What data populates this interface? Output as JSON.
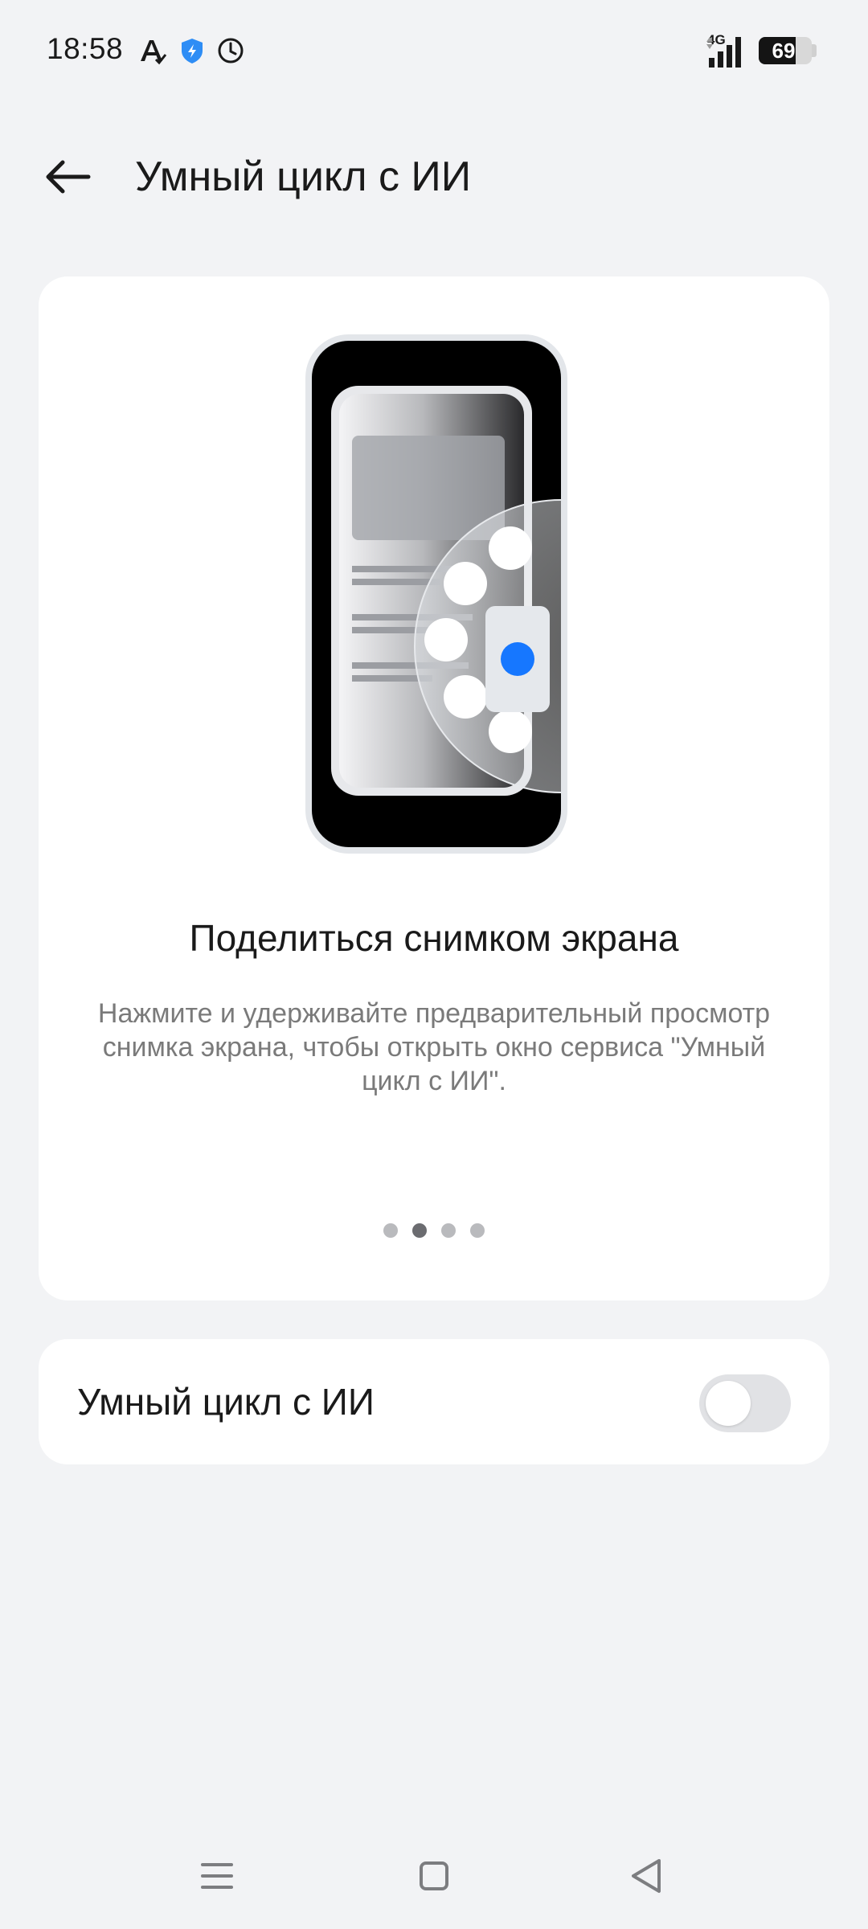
{
  "status_bar": {
    "time": "18:58",
    "notification_icons": [
      "font-app-icon",
      "shield-icon",
      "clock-icon"
    ],
    "network_type": "4G",
    "battery_level": "69"
  },
  "header": {
    "back_icon": "arrow-left-icon",
    "title": "Умный цикл с ИИ"
  },
  "feature_card": {
    "title": "Поделиться снимком экрана",
    "description": "Нажмите и удерживайте предварительный просмотр снимка экрана, чтобы открыть окно сервиса \"Умный цикл с ИИ\".",
    "pages_total": 4,
    "active_page": 2
  },
  "toggle": {
    "label": "Умный цикл с ИИ",
    "enabled": false
  },
  "nav_bar": {
    "buttons": [
      "menu-icon",
      "home-icon",
      "back-triangle-icon"
    ]
  },
  "colors": {
    "background": "#f2f3f5",
    "card": "#ffffff",
    "accent": "#1677ff",
    "text_primary": "#1a1a1a",
    "text_secondary": "#7a7a7a"
  }
}
